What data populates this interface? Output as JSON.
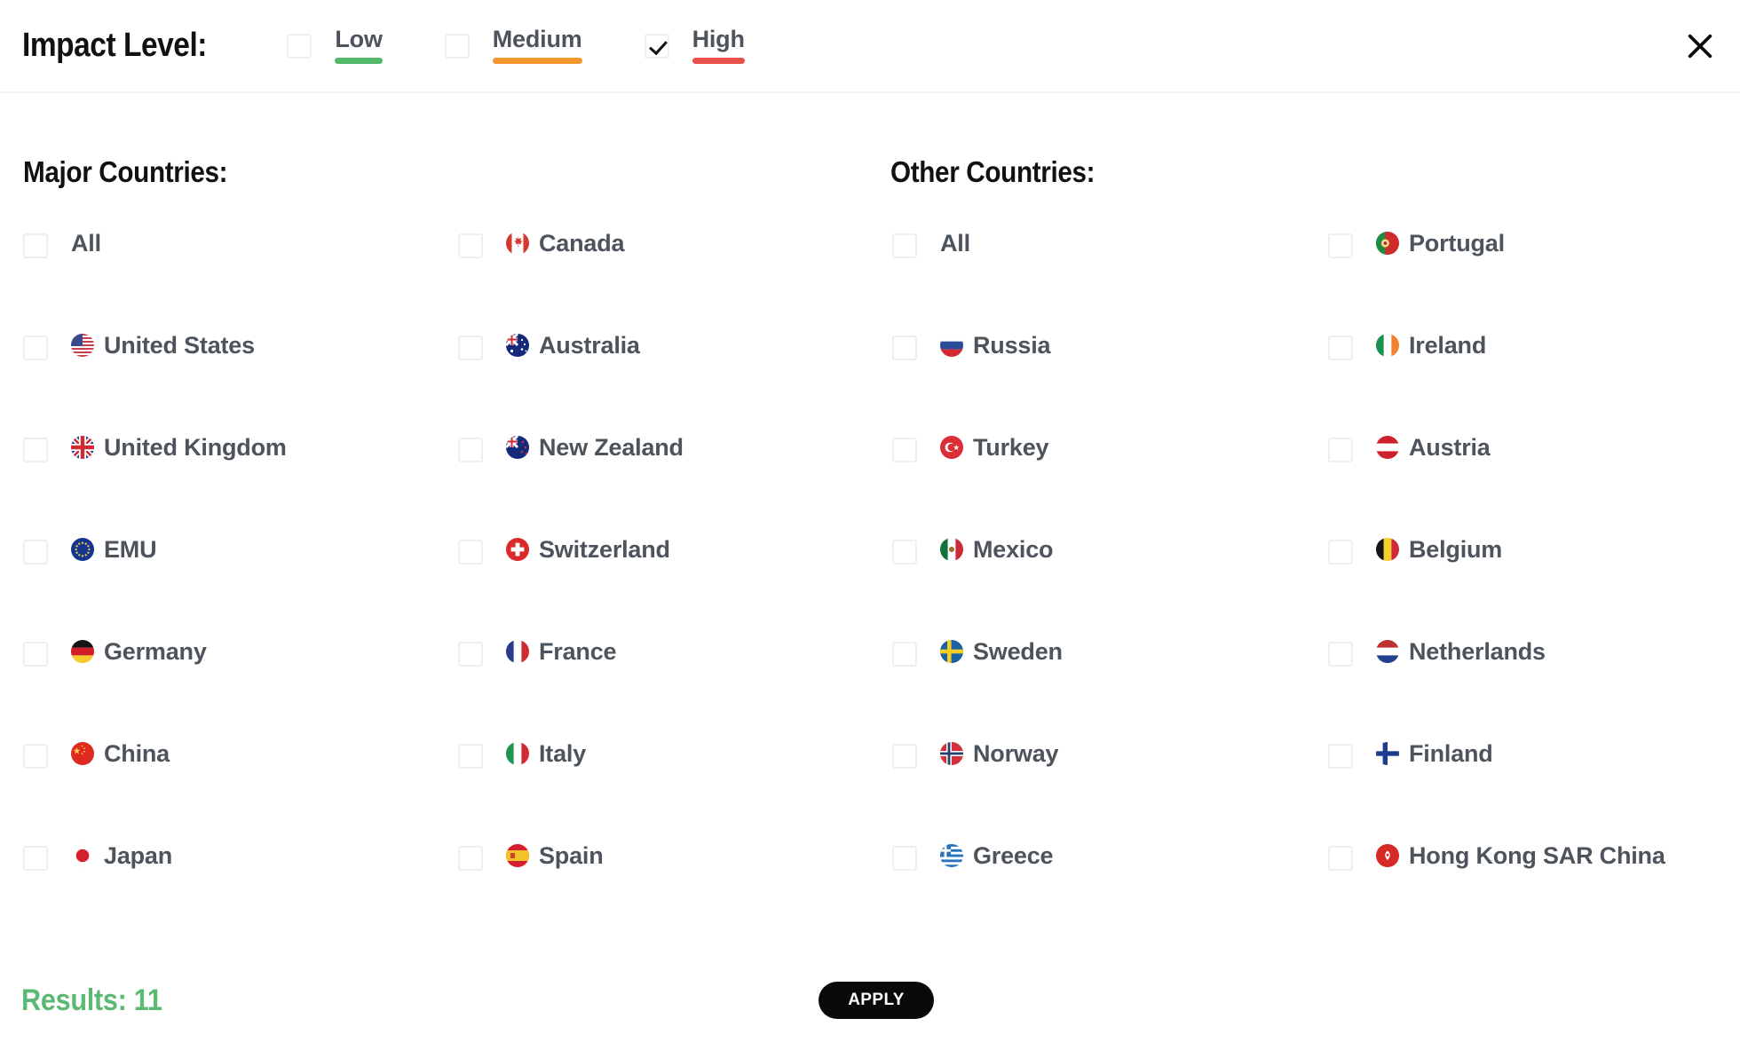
{
  "header": {
    "title": "Impact Level:",
    "close_icon": "close-icon",
    "impact_levels": [
      {
        "label": "Low",
        "checked": false,
        "color": "#53b96a"
      },
      {
        "label": "Medium",
        "checked": false,
        "color": "#f0982d"
      },
      {
        "label": "High",
        "checked": true,
        "color": "#e8514b"
      }
    ]
  },
  "major": {
    "title": "Major Countries:",
    "column_a": [
      {
        "label": "All",
        "flag": "",
        "checked": false
      },
      {
        "label": "United States",
        "flag": "us",
        "checked": false
      },
      {
        "label": "United Kingdom",
        "flag": "gb",
        "checked": false
      },
      {
        "label": "EMU",
        "flag": "eu",
        "checked": false
      },
      {
        "label": "Germany",
        "flag": "de",
        "checked": false
      },
      {
        "label": "China",
        "flag": "cn",
        "checked": false
      },
      {
        "label": "Japan",
        "flag": "jp",
        "checked": false
      }
    ],
    "column_b": [
      {
        "label": "Canada",
        "flag": "ca",
        "checked": false
      },
      {
        "label": "Australia",
        "flag": "au",
        "checked": false
      },
      {
        "label": "New Zealand",
        "flag": "nz",
        "checked": false
      },
      {
        "label": "Switzerland",
        "flag": "ch",
        "checked": false
      },
      {
        "label": "France",
        "flag": "fr",
        "checked": false
      },
      {
        "label": "Italy",
        "flag": "it",
        "checked": false
      },
      {
        "label": "Spain",
        "flag": "es",
        "checked": false
      }
    ]
  },
  "other": {
    "title": "Other Countries:",
    "column_a": [
      {
        "label": "All",
        "flag": "",
        "checked": false
      },
      {
        "label": "Russia",
        "flag": "ru",
        "checked": false
      },
      {
        "label": "Turkey",
        "flag": "tr",
        "checked": false
      },
      {
        "label": "Mexico",
        "flag": "mx",
        "checked": false
      },
      {
        "label": "Sweden",
        "flag": "se",
        "checked": false
      },
      {
        "label": "Norway",
        "flag": "no",
        "checked": false
      },
      {
        "label": "Greece",
        "flag": "gr",
        "checked": false
      }
    ],
    "column_b": [
      {
        "label": "Portugal",
        "flag": "pt",
        "checked": false
      },
      {
        "label": "Ireland",
        "flag": "ie",
        "checked": false
      },
      {
        "label": "Austria",
        "flag": "at",
        "checked": false
      },
      {
        "label": "Belgium",
        "flag": "be",
        "checked": false
      },
      {
        "label": "Netherlands",
        "flag": "nl",
        "checked": false
      },
      {
        "label": "Finland",
        "flag": "fi",
        "checked": false
      },
      {
        "label": "Hong Kong SAR China",
        "flag": "hk",
        "checked": false
      }
    ]
  },
  "footer": {
    "results_label": "Results: 11",
    "results_color": "#5cb974",
    "apply_label": "APPLY"
  }
}
